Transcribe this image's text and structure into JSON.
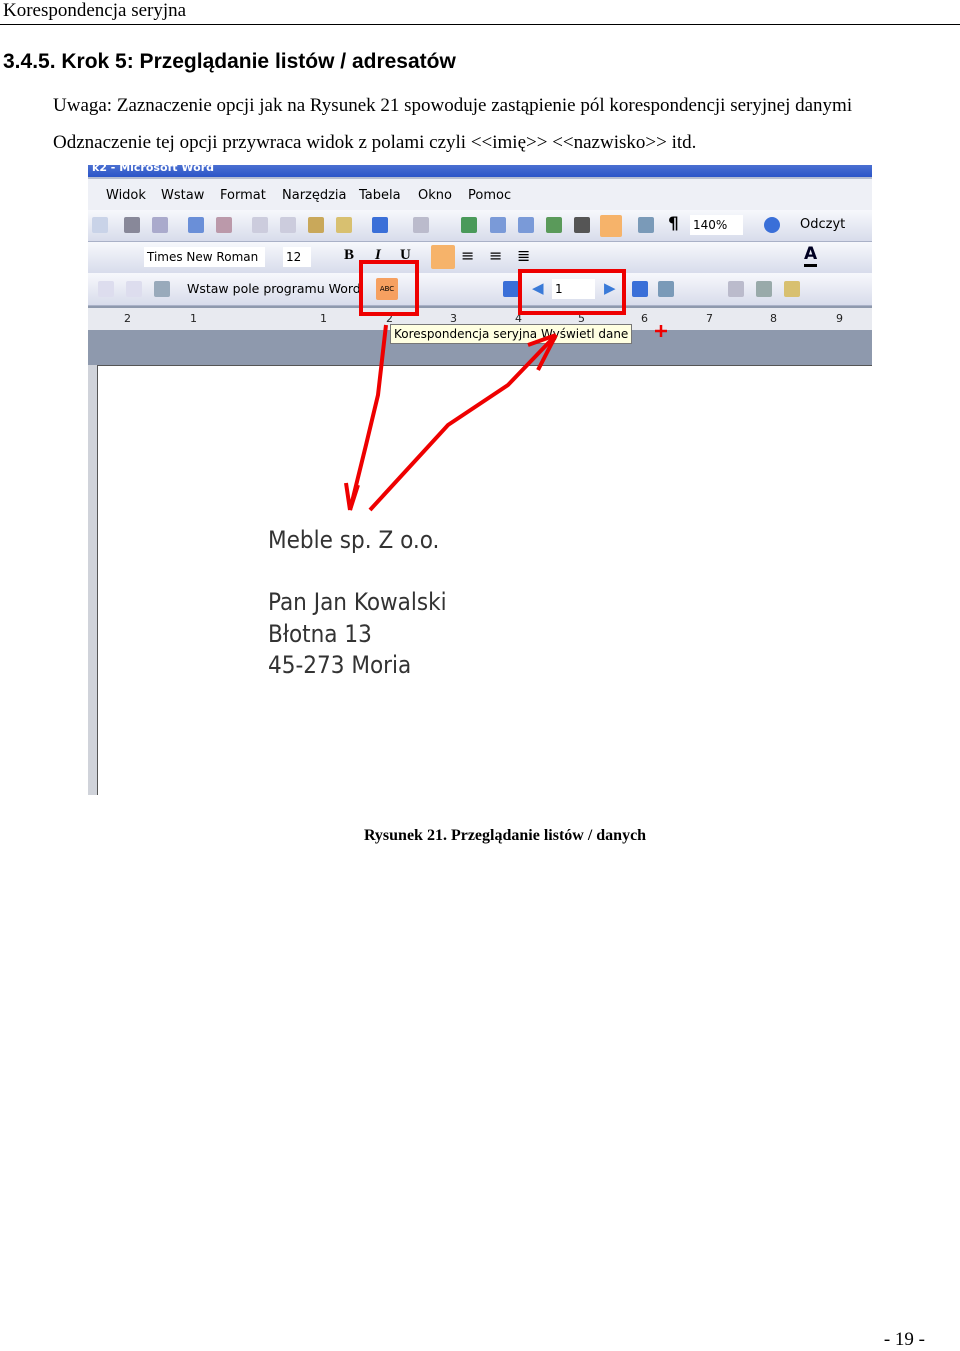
{
  "header": {
    "title": "Korespondencja seryjna"
  },
  "section": {
    "heading": "3.4.5. Krok 5: Przeglądanie listów / adresatów"
  },
  "body": {
    "line1": "Uwaga: Zaznaczenie opcji jak na Rysunek 21 spowoduje zastąpienie pól korespondencji seryjnej danymi",
    "line2": "Odznaczenie tej opcji przywraca widok z polami czyli <<imię>> <<nazwisko>> itd."
  },
  "screenshot": {
    "titlebar": "k2 - Microsoft Word",
    "menu": [
      "Widok",
      "Wstaw",
      "Format",
      "Narzędzia",
      "Tabela",
      "Okno",
      "Pomoc"
    ],
    "zoom": "140%",
    "reading": "Odczyt",
    "font": "Times New Roman",
    "size": "12",
    "insert_field": "Wstaw pole programu Word",
    "record": "1",
    "tooltip": "Korespondencja seryjna Wyświetl dane",
    "ruler": [
      "2",
      "1",
      "1",
      "2",
      "3",
      "4",
      "5",
      "6",
      "7",
      "8",
      "9"
    ],
    "document": [
      "Meble sp. Z o.o.",
      "Pan Jan Kowalski",
      "Błotna 13",
      "45-273 Moria"
    ],
    "highlight_color": "#e00000"
  },
  "caption": "Rysunek 21. Przeglądanie listów / danych",
  "footer": {
    "page": "- 19 -"
  }
}
